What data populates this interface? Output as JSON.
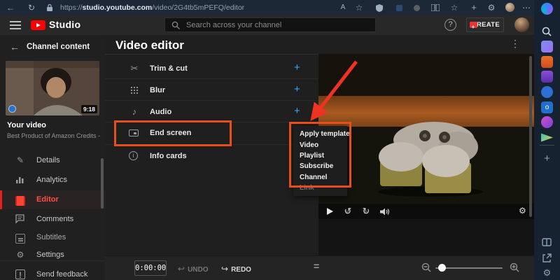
{
  "browser": {
    "url_prefix": "https://",
    "url_domain": "studio.youtube.com",
    "url_path": "/video/2G4tb5mPEFQ/editor"
  },
  "studio_header": {
    "brand": "Studio",
    "search_placeholder": "Search across your channel",
    "create_label": "CREATE"
  },
  "sidebar": {
    "back_label": "Channel content",
    "video_card": {
      "title": "Your video",
      "subtitle": "Best Product of Amazon Credits - A...",
      "duration": "9:18"
    },
    "items": [
      {
        "label": "Details",
        "active": false
      },
      {
        "label": "Analytics",
        "active": false
      },
      {
        "label": "Editor",
        "active": true
      },
      {
        "label": "Comments",
        "active": false
      },
      {
        "label": "Subtitles",
        "active": false
      },
      {
        "label": "Settings",
        "active": false
      },
      {
        "label": "Send feedback",
        "active": false
      }
    ]
  },
  "editor": {
    "title": "Video editor",
    "features": [
      {
        "label": "Trim & cut"
      },
      {
        "label": "Blur"
      },
      {
        "label": "Audio"
      },
      {
        "label": "End screen",
        "highlighted": true
      },
      {
        "label": "Info cards"
      }
    ]
  },
  "popup_menu": {
    "items": [
      {
        "label": "Apply template",
        "disabled": false
      },
      {
        "label": "Video",
        "disabled": false
      },
      {
        "label": "Playlist",
        "disabled": false
      },
      {
        "label": "Subscribe",
        "disabled": false
      },
      {
        "label": "Channel",
        "disabled": false
      },
      {
        "label": "Link",
        "disabled": true
      }
    ]
  },
  "timeline": {
    "timestamp": "0:00:00",
    "undo_label": "UNDO",
    "redo_label": "REDO"
  },
  "annotations": {
    "highlight_color": "#e84d1e",
    "arrow_color": "#ee3420"
  },
  "colors": {
    "accent_red": "#ff4e45",
    "accent_blue": "#3ea6ff",
    "header_bg": "#282828",
    "edge_sidebar_bg": "#16222f"
  },
  "icons": {
    "back": "←",
    "refresh": "↻",
    "plus": "+",
    "kebab": "⋮",
    "help": "?",
    "more": "⋯",
    "text_size": "A",
    "star": "☆",
    "gear": "⚙",
    "scissors": "✂",
    "music_note": "♪",
    "info": "i",
    "pencil": "✎",
    "undo": "↩",
    "redo": "↪",
    "equals": "=",
    "exclaim": "!"
  }
}
